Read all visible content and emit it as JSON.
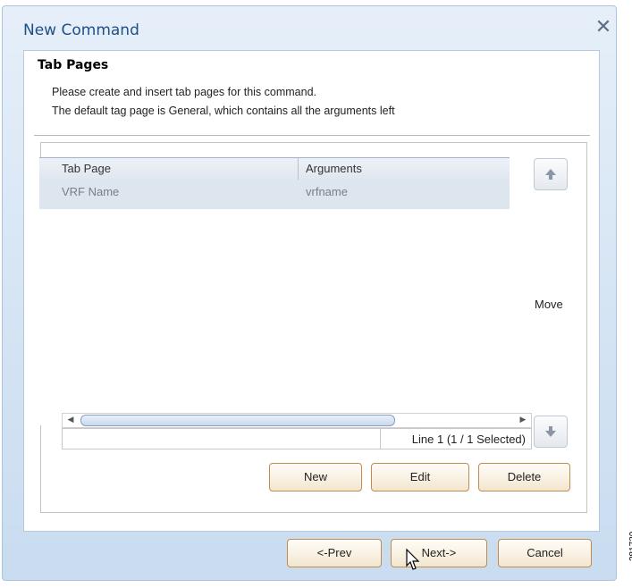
{
  "window": {
    "title": "New Command",
    "close_icon": "close-icon"
  },
  "section": {
    "heading": "Tab Pages",
    "description_line1": "Please create and insert tab pages for this command.",
    "description_line2": "The default tag page is General, which contains all the arguments left"
  },
  "table": {
    "columns": [
      "Tab Page",
      "Arguments"
    ],
    "rows": [
      {
        "tab_page": "VRF Name",
        "arguments": "vrfname"
      }
    ],
    "status": "Line 1 (1 / 1 Selected)"
  },
  "move": {
    "label": "Move",
    "up_icon": "arrow-up-icon",
    "down_icon": "arrow-down-icon"
  },
  "row_buttons": {
    "new": "New",
    "edit": "Edit",
    "delete": "Delete"
  },
  "nav_buttons": {
    "prev": "<-Prev",
    "next": "Next->",
    "cancel": "Cancel"
  },
  "figure_id": "281730"
}
